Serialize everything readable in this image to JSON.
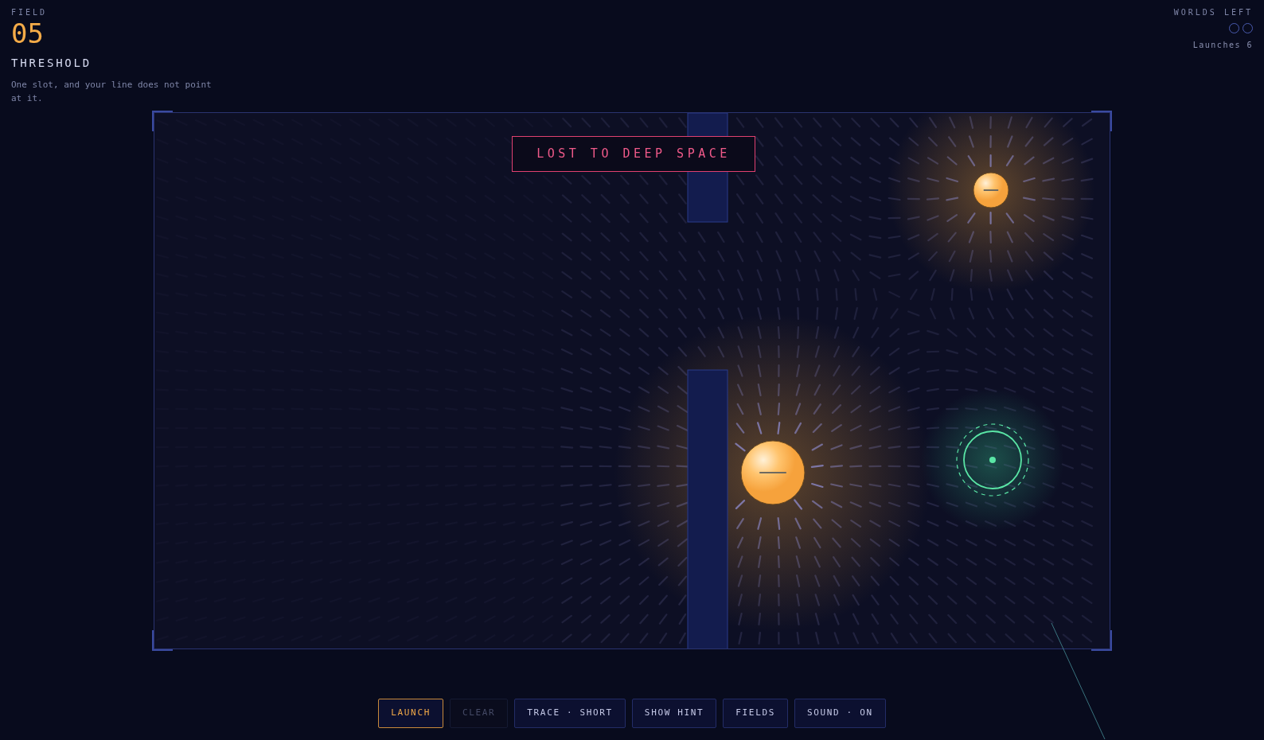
{
  "field": {
    "label": "FIELD",
    "number": "05",
    "title": "THRESHOLD",
    "description": "One slot, and your line does not point at it."
  },
  "worlds_left": {
    "label": "WORLDS LEFT",
    "worlds": [
      {
        "filled": false
      },
      {
        "filled": false
      }
    ],
    "launches": "Launches 6"
  },
  "banner": "LOST TO DEEP SPACE",
  "buttons": [
    {
      "label": "LAUNCH",
      "kind": "primary"
    },
    {
      "label": "CLEAR",
      "kind": "disabled"
    },
    {
      "label": "TRACE · SHORT",
      "kind": "normal"
    },
    {
      "label": "SHOW HINT",
      "kind": "normal"
    },
    {
      "label": "FIELDS",
      "kind": "normal"
    },
    {
      "label": "SOUND · ON",
      "kind": "normal"
    }
  ]
}
